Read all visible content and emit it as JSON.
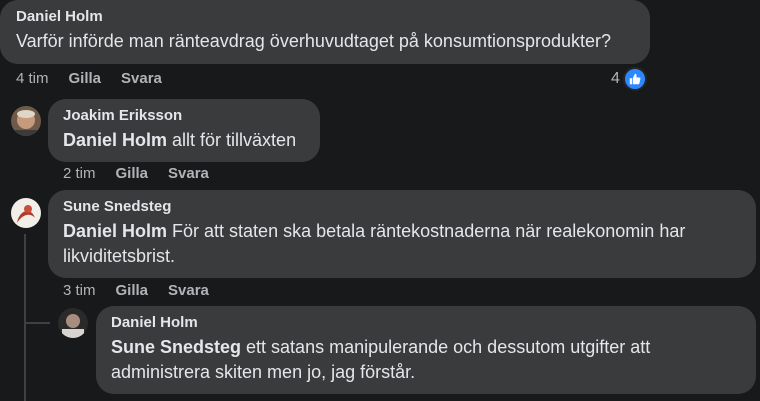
{
  "comments": [
    {
      "author": "Daniel Holm",
      "text": "Varför införde man ränteavdrag överhuvudtaget på konsumtionsprodukter?",
      "time": "4 tim",
      "like_label": "Gilla",
      "reply_label": "Svara",
      "reaction_count": "4"
    },
    {
      "author": "Joakim Eriksson",
      "mention": "Daniel Holm",
      "text": " allt för tillväxten",
      "time": "2 tim",
      "like_label": "Gilla",
      "reply_label": "Svara"
    },
    {
      "author": "Sune Snedsteg",
      "mention": "Daniel Holm",
      "text": " För att staten ska betala räntekostnaderna när realekonomin har likviditetsbrist.",
      "time": "3 tim",
      "like_label": "Gilla",
      "reply_label": "Svara"
    },
    {
      "author": "Daniel Holm",
      "mention": "Sune Snedsteg",
      "text": " ett satans manipulerande och dessutom utgifter att administrera skiten men jo, jag förstår."
    }
  ],
  "icons": {
    "like_reaction": "thumbs-up-icon"
  },
  "colors": {
    "background": "#18191a",
    "bubble": "#3a3b3c",
    "like_blue": "#2d88ff"
  }
}
